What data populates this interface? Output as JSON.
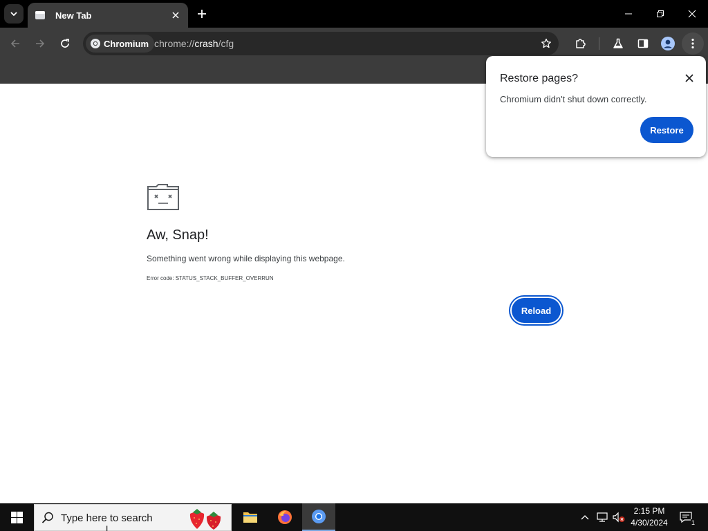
{
  "window": {
    "tab_title": "New Tab",
    "controls": [
      "minimize",
      "restore",
      "close"
    ]
  },
  "toolbar": {
    "site_chip_label": "Chromium",
    "url_scheme": "chrome://",
    "url_host": "crash",
    "url_path": "/cfg"
  },
  "crash_page": {
    "title": "Aw, Snap!",
    "message": "Something went wrong while displaying this webpage.",
    "error_code": "Error code: STATUS_STACK_BUFFER_OVERRUN",
    "reload_label": "Reload"
  },
  "restore_bubble": {
    "title": "Restore pages?",
    "message": "Chromium didn't shut down correctly.",
    "restore_label": "Restore"
  },
  "taskbar": {
    "search_placeholder": "Type here to search",
    "apps": [
      "file-explorer",
      "firefox",
      "chromium"
    ],
    "active_app": "chromium",
    "time": "2:15 PM",
    "date": "4/30/2024",
    "notification_count": "1"
  },
  "colors": {
    "accent_blue": "#0b57d0",
    "toolbar_bg": "#3c3c3c",
    "titlebar_bg": "#000000",
    "taskbar_bg": "#101010"
  }
}
